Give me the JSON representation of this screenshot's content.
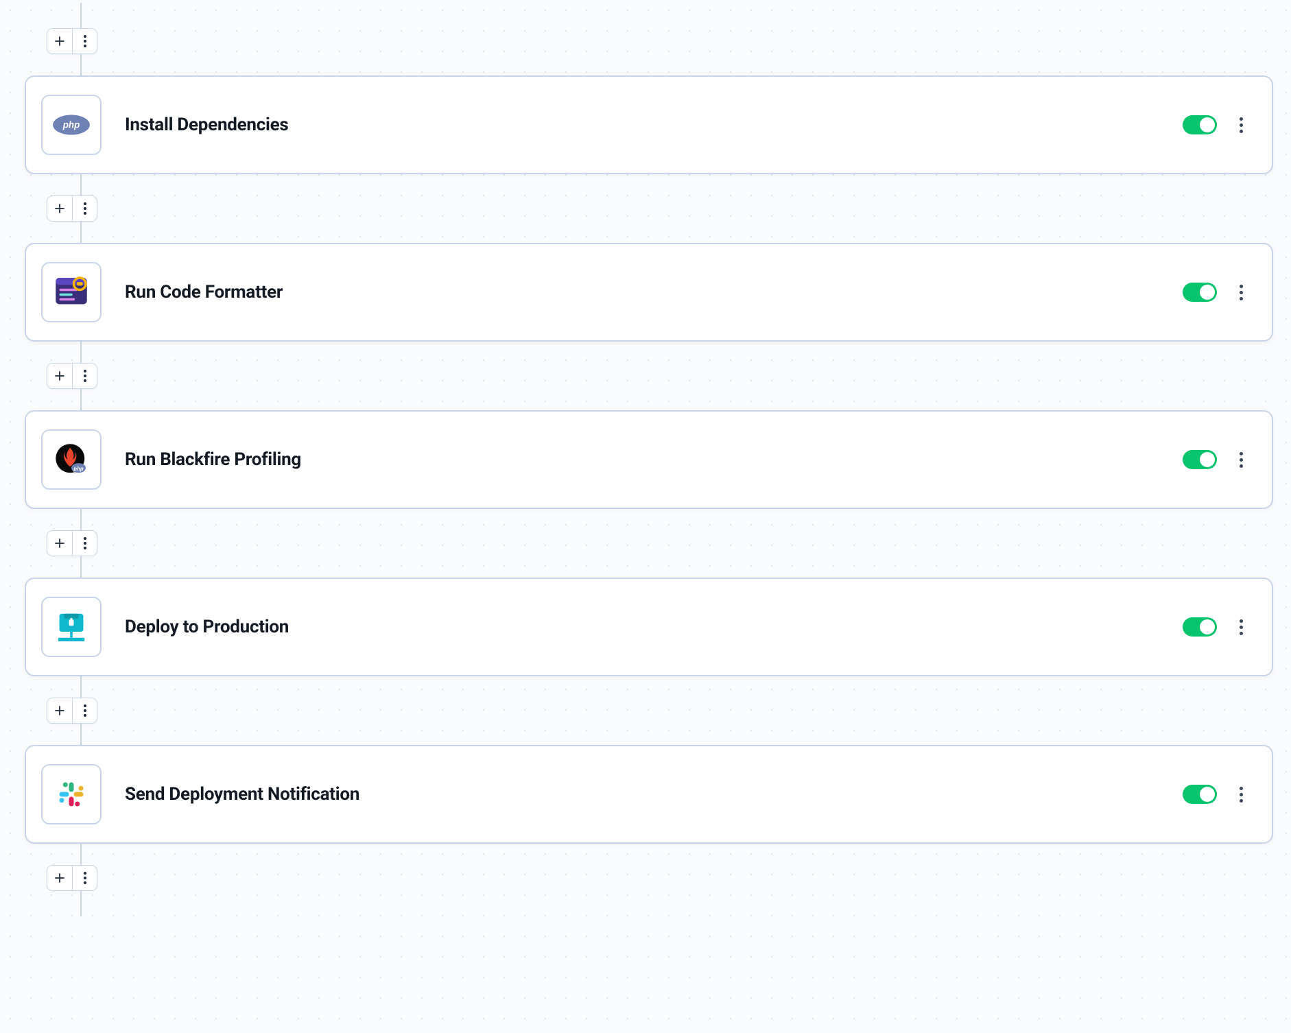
{
  "steps": [
    {
      "title": "Install Dependencies",
      "icon": "php-icon",
      "enabled": true
    },
    {
      "title": "Run Code Formatter",
      "icon": "code-review-icon",
      "enabled": true
    },
    {
      "title": "Run Blackfire Profiling",
      "icon": "blackfire-icon",
      "enabled": true
    },
    {
      "title": "Deploy to Production",
      "icon": "deploy-icon",
      "enabled": true
    },
    {
      "title": "Send Deployment Notification",
      "icon": "slack-icon",
      "enabled": true
    }
  ],
  "colors": {
    "toggle_on": "#05c46b",
    "card_border": "#c9d4e8"
  }
}
